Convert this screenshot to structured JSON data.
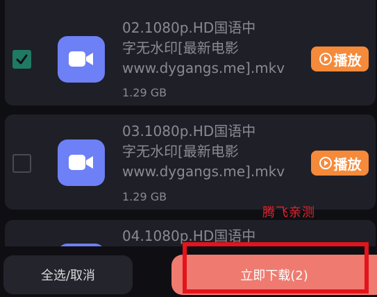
{
  "items": [
    {
      "title_lines": [
        "02.1080p.HD国语中",
        "字无水印[最新电影",
        "www.dygangs.me].mkv"
      ],
      "size": "1.29 GB",
      "checked": true,
      "play_label": "播放"
    },
    {
      "title_lines": [
        "03.1080p.HD国语中",
        "字无水印[最新电影",
        "www.dygangs.me].mkv"
      ],
      "size": "1.29 GB",
      "checked": false,
      "play_label": "播放"
    },
    {
      "title_lines": [
        "04.1080p.HD国语中"
      ],
      "checked": false
    }
  ],
  "watermark_text": "腾飞亲测",
  "footer": {
    "select_all_label": "全选/取消",
    "download_label": "立即下载(2)"
  },
  "colors": {
    "checkbox_checked": "#1f7a63",
    "video_tile": "#6e80f6",
    "play_button": "#f58a3a",
    "download_button": "#ef7b70",
    "highlight_frame": "#e3141c"
  },
  "icons": {
    "checkbox": "checkmark-icon",
    "video": "video-camera-icon",
    "play": "play-circle-icon"
  }
}
